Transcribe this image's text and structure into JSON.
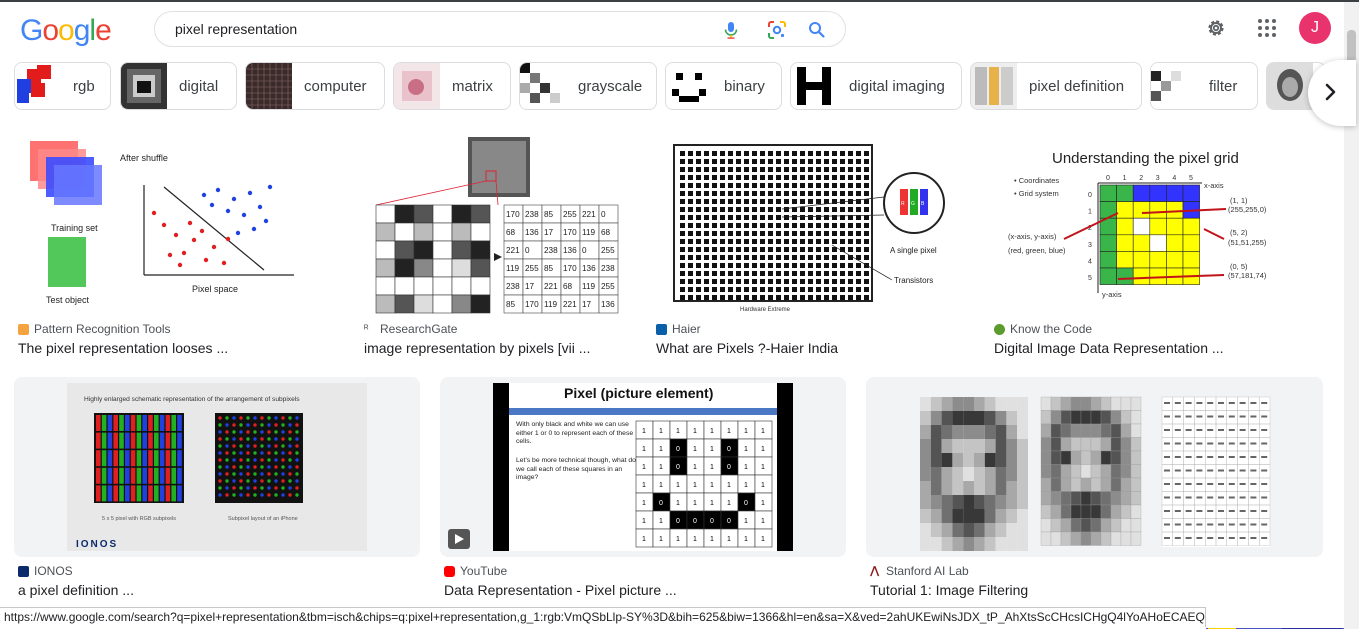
{
  "logo": [
    "G",
    "o",
    "o",
    "g",
    "l",
    "e"
  ],
  "search": {
    "query": "pixel representation"
  },
  "header": {
    "avatar_letter": "J"
  },
  "chips": [
    {
      "label": "rgb"
    },
    {
      "label": "digital"
    },
    {
      "label": "computer"
    },
    {
      "label": "matrix"
    },
    {
      "label": "grayscale"
    },
    {
      "label": "binary"
    },
    {
      "label": "digital imaging"
    },
    {
      "label": "pixel definition"
    },
    {
      "label": "filter"
    }
  ],
  "results": [
    {
      "source": "Pattern Recognition Tools",
      "title": "The pixel representation looses ...",
      "favicon_color": "#f4a340",
      "image_text": [
        "After shuffle",
        "Training set",
        "Test object",
        "Pixel space"
      ]
    },
    {
      "source": "ResearchGate",
      "title": "image representation by pixels [vii ...",
      "favicon_color": "#ffffff",
      "image_text": [
        "170",
        "238",
        "85",
        "255",
        "221",
        "0",
        "68",
        "136",
        "17",
        "170",
        "119",
        "68",
        "221",
        "0",
        "238",
        "136",
        "0",
        "255",
        "119",
        "255",
        "85",
        "170",
        "136",
        "238",
        "238",
        "17",
        "221",
        "68",
        "119",
        "255",
        "85",
        "170",
        "119",
        "221",
        "17",
        "136"
      ]
    },
    {
      "source": "Haier",
      "title": "What are Pixels ?-Haier India",
      "favicon_color": "#0b5ea8",
      "image_text": [
        "A single pixel",
        "Transistors",
        "Hardware Extreme",
        "R",
        "G",
        "B"
      ]
    },
    {
      "source": "Know the Code",
      "title": "Digital Image Data Representation ...",
      "favicon_color": "#5b9b2e",
      "image_text": [
        "Understanding the pixel grid",
        "• Coordinates",
        "• Grid system",
        "(x-axis, y-axis)",
        "(red, green, blue)",
        "x-axis",
        "y-axis",
        "(1, 1)",
        "(255,255,0)",
        "(5, 2)",
        "(51,51,255)",
        "(0, 5)",
        "(57,181,74)"
      ]
    },
    {
      "source": "IONOS",
      "title": "a pixel definition ...",
      "favicon_color": "#0b2a6b",
      "image_text": [
        "Highly enlarged schematic representation of the arrangement of subpixels",
        "5 x 5 pixel with RGB subpixels",
        "Subpixel layout of an iPhone",
        "IONOS"
      ]
    },
    {
      "source": "YouTube",
      "title": "Data Representation - Pixel picture ...",
      "favicon_color": "#ff0000",
      "image_text": [
        "Pixel (picture element)",
        "With only black and white we can use either 1 or 0 to represent each of these cells.",
        "Let's be more technical though, what do we call each of these squares in an image?"
      ]
    },
    {
      "source": "Stanford AI Lab",
      "title": "Tutorial 1: Image Filtering",
      "favicon_color": "#8c1515",
      "image_text": []
    }
  ],
  "status_url": "https://www.google.com/search?q=pixel+representation&tbm=isch&chips=q:pixel+representation,g_1:rgb:VmQSbLlp-SY%3D&bih=625&biw=1366&hl=en&sa=X&ved=2ahUKEwiNsJDX_tP_AhXtsScCHcsICHgQ4lYoAHoECAEQJw",
  "colors": {
    "accent": "#1a73e8",
    "avatar": "#e8336d"
  },
  "icons": [
    "mic-icon",
    "lens-icon",
    "search-icon",
    "gear-icon",
    "apps-icon",
    "chevron-right-icon"
  ]
}
